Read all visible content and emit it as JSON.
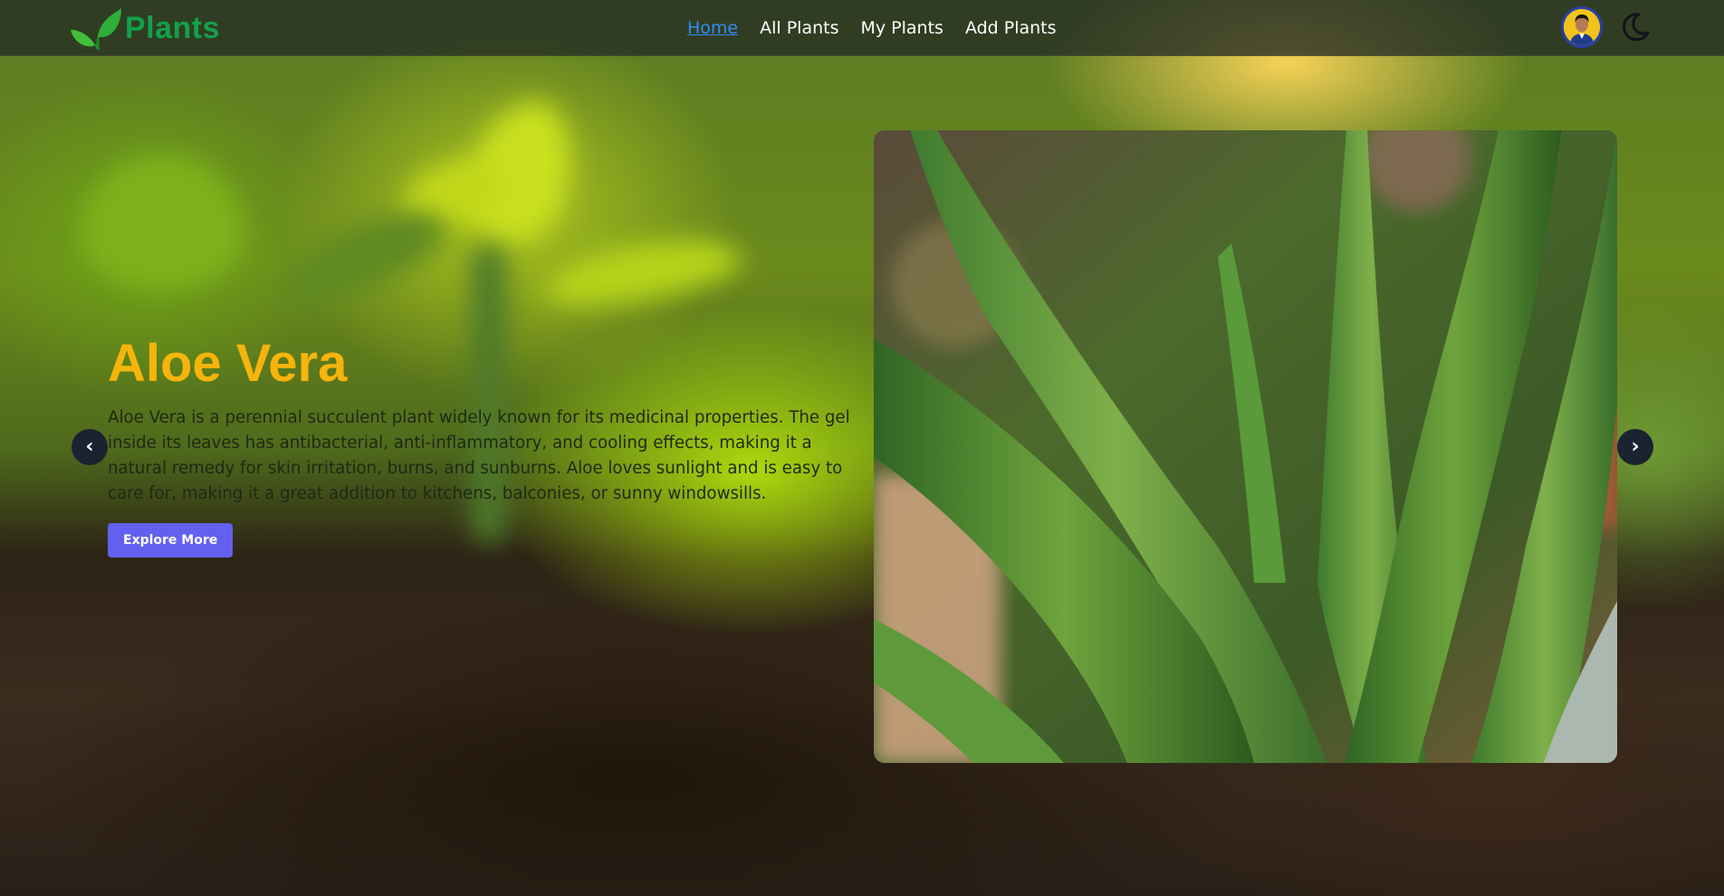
{
  "navbar": {
    "brand_name": "Plants",
    "brand_icon": "leaf-icon",
    "links": [
      {
        "label": "Home",
        "active": true
      },
      {
        "label": "All Plants",
        "active": false
      },
      {
        "label": "My Plants",
        "active": false
      },
      {
        "label": "Add Plants",
        "active": false
      }
    ],
    "avatar_icon": "user-avatar",
    "theme_toggle_icon": "moon-icon"
  },
  "hero": {
    "title": "Aloe Vera",
    "description": "Aloe Vera is a perennial succulent plant widely known for its medicinal properties. The gel inside its leaves has antibacterial, anti-inflammatory, and cooling effects, making it a natural remedy for skin irritation, burns, and sunburns. Aloe loves sunlight and is easy to care for, making it a great addition to kitchens, balconies, or sunny windowsills.",
    "button_label": "Explore More",
    "prev_arrow": "‹",
    "next_arrow": "›"
  },
  "colors": {
    "brand": "#12a14a",
    "active_link": "#2f8df5",
    "title": "#f5b40c",
    "button": "#6360f0"
  }
}
